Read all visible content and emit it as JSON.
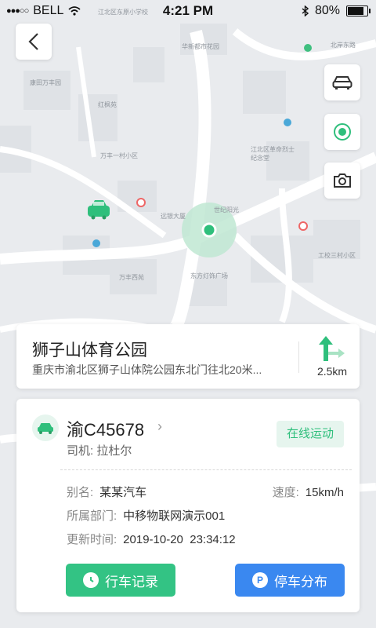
{
  "status_bar": {
    "carrier": "BELL",
    "time": "4:21 PM",
    "battery": "80%"
  },
  "map": {
    "pois": [
      "江北区东原小学校",
      "华新都市花园",
      "康田万丰园",
      "红枫苑",
      "万丰一村小区",
      "远银大厦",
      "世纪阳光",
      "东方灯饰广场",
      "万丰西苑",
      "工校三村小区",
      "江北区革命烈士纪念堂",
      "北岸东路"
    ]
  },
  "destination": {
    "title": "狮子山体育公园",
    "address": "重庆市渝北区狮子山体院公园东北门往北20米...",
    "distance": "2.5km"
  },
  "vehicle": {
    "plate": "渝C45678",
    "driver": "司机: 拉杜尔",
    "status": "在线运动",
    "alias_label": "别名:",
    "alias_value": "某某汽车",
    "speed_label": "速度:",
    "speed_value": "15km/h",
    "dept_label": "所属部门:",
    "dept_value": "中移物联网演示001",
    "update_label": "更新时间:",
    "update_value": "2019-10-20  23:34:12",
    "btn_record": "行车记录",
    "btn_parking": "停车分布",
    "parking_icon_letter": "P"
  },
  "colors": {
    "accent_green": "#33c384",
    "accent_blue": "#3a88f0"
  }
}
